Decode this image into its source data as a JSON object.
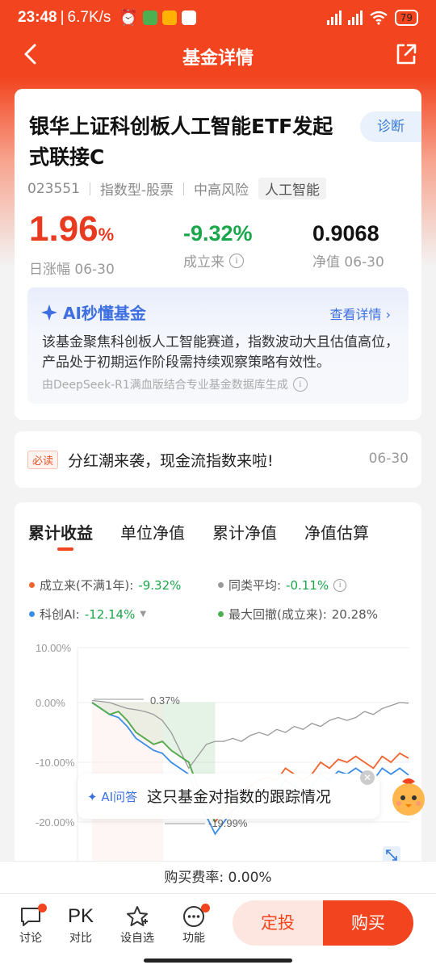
{
  "status": {
    "time": "23:48",
    "speed": "6.7K/s",
    "battery": "79",
    "net1": "HD",
    "net2": "HD"
  },
  "nav": {
    "title": "基金详情"
  },
  "fund": {
    "name": "银华上证科创板人工智能ETF发起式联接C",
    "diagnose": "诊断",
    "code": "023551",
    "type": "指数型-股票",
    "risk": "中高风险",
    "theme": "人工智能"
  },
  "metrics": {
    "day_change": "1.96",
    "day_change_unit": "%",
    "day_change_label": "日涨幅 06-30",
    "since_inception": "-9.32%",
    "since_inception_label": "成立来",
    "nav": "0.9068",
    "nav_label": "净值 06-30"
  },
  "ai_summary": {
    "title": "AI秒懂基金",
    "more": "查看详情",
    "text": "该基金聚焦科创板人工智能赛道，指数波动大且估值高位，产品处于初期运作阶段需持续观察策略有效性。",
    "source": "由DeepSeek-R1满血版结合专业基金数据库生成"
  },
  "news": {
    "tag": "必读",
    "text": "分红潮来袭，现金流指数来啦!",
    "date": "06-30"
  },
  "chart_tabs": [
    "累计收益",
    "单位净值",
    "累计净值",
    "净值估算"
  ],
  "legend": {
    "a_label": "成立来(不满1年):",
    "a_value": "-9.32%",
    "b_label": "同类平均:",
    "b_value": "-0.11%",
    "c_label": "科创AI:",
    "c_value": "-12.14%",
    "d_label": "最大回撤(成立来):",
    "d_value": "20.28%"
  },
  "chart_data": {
    "type": "line",
    "y_ticks": [
      "10.00%",
      "0.00%",
      "-10.00%",
      "-20.00%"
    ],
    "ylim": [
      -22,
      10
    ],
    "annotations": [
      "0.37%",
      "-19.99%"
    ],
    "series": [
      {
        "name": "成立来",
        "color": "#f0642e",
        "values": [
          0,
          -1,
          -2,
          -1.5,
          -3,
          -5,
          -6,
          -7,
          -6.5,
          -8,
          -9,
          -10,
          -14,
          -17,
          -19.99,
          -18,
          -16,
          -15,
          -14,
          -13,
          -12.5,
          -13,
          -11,
          -12,
          -13,
          -12,
          -10,
          -11,
          -9.5,
          -10,
          -9,
          -10,
          -11,
          -9,
          -10,
          -8.5,
          -9.32
        ]
      },
      {
        "name": "同类平均",
        "color": "#999999",
        "values": [
          0.37,
          0.2,
          0,
          -0.5,
          -1,
          -1.2,
          -1.5,
          -2,
          -3,
          -5,
          -8,
          -11,
          -9,
          -7,
          -6.5,
          -6.5,
          -6,
          -6.5,
          -5.5,
          -5,
          -5.5,
          -4.5,
          -5,
          -4,
          -4.5,
          -3.5,
          -4,
          -3,
          -2.5,
          -3,
          -2.5,
          -1.5,
          -2,
          -1,
          -0.5,
          0,
          -0.11
        ]
      },
      {
        "name": "科创AI",
        "color": "#3a8ee6",
        "values": [
          0,
          -1,
          -2,
          -2.5,
          -4,
          -6,
          -7,
          -8,
          -8.5,
          -10,
          -11,
          -12,
          -16,
          -19,
          -22,
          -20,
          -18,
          -17,
          -16,
          -15,
          -14.5,
          -15,
          -13,
          -14,
          -15,
          -14,
          -12,
          -13,
          -11.5,
          -12,
          -11,
          -12,
          -13,
          -11,
          -12,
          -11,
          -12.14
        ]
      }
    ]
  },
  "ai_prompt": {
    "tag": "AI问答",
    "question": "这只基金对指数的跟踪情况"
  },
  "fee": "购买费率: 0.00%",
  "bottom_bar": {
    "items": [
      "讨论",
      "对比",
      "设自选",
      "功能"
    ],
    "pk": "PK",
    "dingtou": "定投",
    "buy": "购买"
  }
}
